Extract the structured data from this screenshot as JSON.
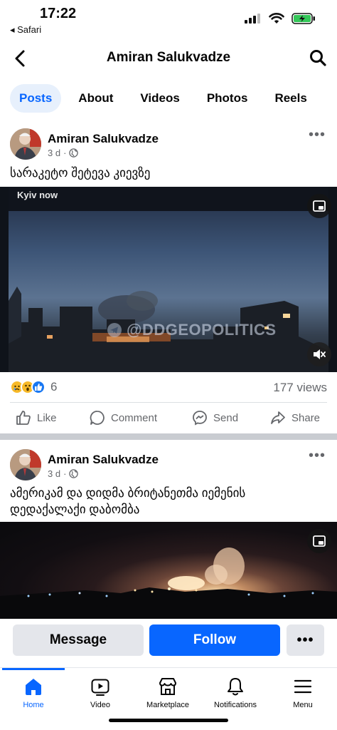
{
  "status_bar": {
    "time": "17:22",
    "back_app": "◂ Safari"
  },
  "header": {
    "title": "Amiran Salukvadze"
  },
  "tabs": [
    {
      "label": "Posts",
      "active": true
    },
    {
      "label": "About"
    },
    {
      "label": "Videos"
    },
    {
      "label": "Photos"
    },
    {
      "label": "Reels"
    }
  ],
  "posts": [
    {
      "author": "Amiran Salukvadze",
      "time": "3 d",
      "caption": "სარაკეტო შეტევა კიევზე",
      "video_overlay_label": "Kyiv now",
      "watermark": "@DDGEOPOLITICS",
      "reaction_count": "6",
      "views": "177 views"
    },
    {
      "author": "Amiran Salukvadze",
      "time": "3 d",
      "caption": "ამერიკამ და დიდმა ბრიტანეთმა იემენის დედაქალაქი დაბომბა"
    }
  ],
  "post_actions": {
    "like": "Like",
    "comment": "Comment",
    "send": "Send",
    "share": "Share"
  },
  "cta": {
    "message": "Message",
    "follow": "Follow",
    "more": "•••"
  },
  "bottom_nav": [
    {
      "label": "Home",
      "icon": "home-icon",
      "active": true
    },
    {
      "label": "Video",
      "icon": "video-icon"
    },
    {
      "label": "Marketplace",
      "icon": "marketplace-icon"
    },
    {
      "label": "Notifications",
      "icon": "bell-icon"
    },
    {
      "label": "Menu",
      "icon": "menu-icon"
    }
  ],
  "colors": {
    "accent": "#0866ff",
    "tab_active_bg": "#e7f0fc",
    "secondary_text": "#65676b"
  }
}
